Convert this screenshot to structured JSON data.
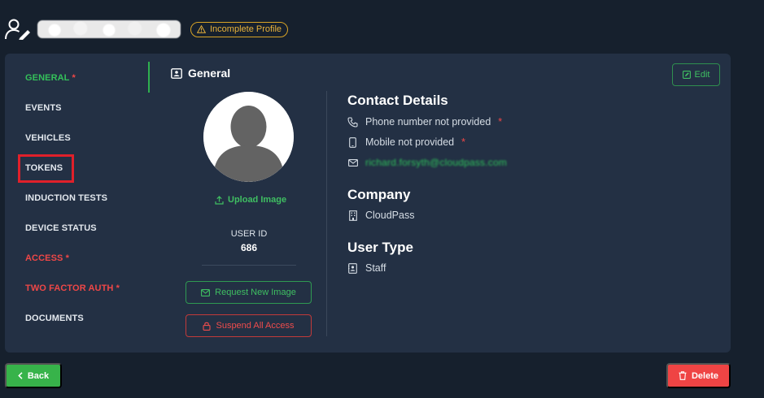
{
  "header": {
    "user_name_redacted": "",
    "badge_label": "Incomplete Profile",
    "icons": {
      "user": "user-edit-icon",
      "badge": "warning-triangle-icon"
    }
  },
  "nav": {
    "items": [
      {
        "label": "GENERAL",
        "required": "*",
        "state": "active"
      },
      {
        "label": "EVENTS",
        "required": "",
        "state": "normal"
      },
      {
        "label": "VEHICLES",
        "required": "",
        "state": "normal"
      },
      {
        "label": "TOKENS",
        "required": "",
        "state": "highlighted"
      },
      {
        "label": "INDUCTION TESTS",
        "required": "",
        "state": "normal"
      },
      {
        "label": "DEVICE STATUS",
        "required": "",
        "state": "normal"
      },
      {
        "label": "ACCESS",
        "required": "*",
        "state": "alert"
      },
      {
        "label": "TWO FACTOR AUTH",
        "required": "*",
        "state": "alert"
      },
      {
        "label": "DOCUMENTS",
        "required": "",
        "state": "normal"
      }
    ]
  },
  "general": {
    "title": "General",
    "edit_label": "Edit",
    "upload_label": "Upload Image",
    "user_id_label": "USER ID",
    "user_id_value": "686",
    "request_image_label": "Request New Image",
    "suspend_label": "Suspend All Access"
  },
  "contact": {
    "title": "Contact Details",
    "phone": "Phone number not provided",
    "mobile": "Mobile not provided",
    "required_mark": "*",
    "email_redacted": "richard.forsyth@cloudpass.com"
  },
  "company": {
    "title": "Company",
    "name": "CloudPass"
  },
  "user_type": {
    "title": "User Type",
    "value": "Staff"
  },
  "footer": {
    "back_label": "Back",
    "delete_label": "Delete"
  },
  "colors": {
    "background": "#16202d",
    "card": "#233044",
    "accent_green": "#37b34a",
    "danger": "#ef4444",
    "warning": "#e8b23a",
    "highlight_box": "#e0202a"
  }
}
